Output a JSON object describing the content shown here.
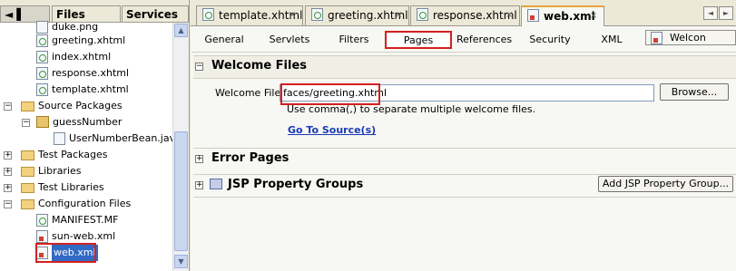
{
  "left_tabs": {
    "projects_glyph": "◄ ▌",
    "files": "Files",
    "services": "Services"
  },
  "tree": [
    {
      "label": "duke.png",
      "icon": "image-file-icon"
    },
    {
      "label": "greeting.xhtml",
      "icon": "xhtml-file-icon"
    },
    {
      "label": "index.xhtml",
      "icon": "xhtml-file-icon"
    },
    {
      "label": "response.xhtml",
      "icon": "xhtml-file-icon"
    },
    {
      "label": "template.xhtml",
      "icon": "xhtml-file-icon"
    },
    {
      "label": "Source Packages",
      "icon": "folder-icon"
    },
    {
      "label": "guessNumber",
      "icon": "package-icon"
    },
    {
      "label": "UserNumberBean.java",
      "icon": "java-file-icon"
    },
    {
      "label": "Test Packages",
      "icon": "folder-icon"
    },
    {
      "label": "Libraries",
      "icon": "folder-icon"
    },
    {
      "label": "Test Libraries",
      "icon": "folder-icon"
    },
    {
      "label": "Configuration Files",
      "icon": "folder-icon"
    },
    {
      "label": "MANIFEST.MF",
      "icon": "manifest-file-icon"
    },
    {
      "label": "sun-web.xml",
      "icon": "xml-file-icon"
    },
    {
      "label": "web.xml",
      "icon": "xml-file-icon"
    }
  ],
  "editor_tabs": [
    {
      "label": "template.xhtml",
      "active": false
    },
    {
      "label": "greeting.xhtml",
      "active": false
    },
    {
      "label": "response.xhtml",
      "active": false
    },
    {
      "label": "web.xml",
      "active": true
    }
  ],
  "close_glyph": "×",
  "section_tabs": [
    "General",
    "Servlets",
    "Filters",
    "Pages",
    "References",
    "Security",
    "XML"
  ],
  "selected_section_tab": "Pages",
  "welcome_button": "Welcon",
  "welcome_section": {
    "title": "Welcome Files",
    "field_label": "Welcome Files:",
    "field_value": "faces/greeting.xhtml",
    "browse_label": "Browse...",
    "hint": "Use comma(,) to separate multiple welcome files.",
    "go_to_source": "Go To Source(s)"
  },
  "error_section": {
    "title": "Error Pages"
  },
  "jsp_section": {
    "title": "JSP Property Groups",
    "add_label": "Add JSP Property Group..."
  },
  "colors": {
    "highlight_red": "#d42020",
    "link_blue": "#1a3ab8",
    "selection_blue": "#316ac5"
  }
}
